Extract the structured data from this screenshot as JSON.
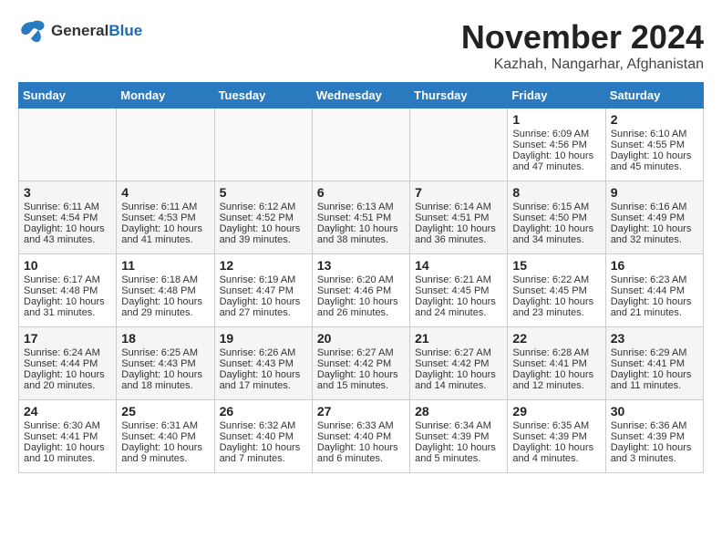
{
  "header": {
    "logo_line1": "General",
    "logo_line2": "Blue",
    "month_title": "November 2024",
    "location": "Kazhah, Nangarhar, Afghanistan"
  },
  "calendar": {
    "days_of_week": [
      "Sunday",
      "Monday",
      "Tuesday",
      "Wednesday",
      "Thursday",
      "Friday",
      "Saturday"
    ],
    "weeks": [
      [
        {
          "day": "",
          "content": ""
        },
        {
          "day": "",
          "content": ""
        },
        {
          "day": "",
          "content": ""
        },
        {
          "day": "",
          "content": ""
        },
        {
          "day": "",
          "content": ""
        },
        {
          "day": "1",
          "content": "Sunrise: 6:09 AM\nSunset: 4:56 PM\nDaylight: 10 hours\nand 47 minutes."
        },
        {
          "day": "2",
          "content": "Sunrise: 6:10 AM\nSunset: 4:55 PM\nDaylight: 10 hours\nand 45 minutes."
        }
      ],
      [
        {
          "day": "3",
          "content": "Sunrise: 6:11 AM\nSunset: 4:54 PM\nDaylight: 10 hours\nand 43 minutes."
        },
        {
          "day": "4",
          "content": "Sunrise: 6:11 AM\nSunset: 4:53 PM\nDaylight: 10 hours\nand 41 minutes."
        },
        {
          "day": "5",
          "content": "Sunrise: 6:12 AM\nSunset: 4:52 PM\nDaylight: 10 hours\nand 39 minutes."
        },
        {
          "day": "6",
          "content": "Sunrise: 6:13 AM\nSunset: 4:51 PM\nDaylight: 10 hours\nand 38 minutes."
        },
        {
          "day": "7",
          "content": "Sunrise: 6:14 AM\nSunset: 4:51 PM\nDaylight: 10 hours\nand 36 minutes."
        },
        {
          "day": "8",
          "content": "Sunrise: 6:15 AM\nSunset: 4:50 PM\nDaylight: 10 hours\nand 34 minutes."
        },
        {
          "day": "9",
          "content": "Sunrise: 6:16 AM\nSunset: 4:49 PM\nDaylight: 10 hours\nand 32 minutes."
        }
      ],
      [
        {
          "day": "10",
          "content": "Sunrise: 6:17 AM\nSunset: 4:48 PM\nDaylight: 10 hours\nand 31 minutes."
        },
        {
          "day": "11",
          "content": "Sunrise: 6:18 AM\nSunset: 4:48 PM\nDaylight: 10 hours\nand 29 minutes."
        },
        {
          "day": "12",
          "content": "Sunrise: 6:19 AM\nSunset: 4:47 PM\nDaylight: 10 hours\nand 27 minutes."
        },
        {
          "day": "13",
          "content": "Sunrise: 6:20 AM\nSunset: 4:46 PM\nDaylight: 10 hours\nand 26 minutes."
        },
        {
          "day": "14",
          "content": "Sunrise: 6:21 AM\nSunset: 4:45 PM\nDaylight: 10 hours\nand 24 minutes."
        },
        {
          "day": "15",
          "content": "Sunrise: 6:22 AM\nSunset: 4:45 PM\nDaylight: 10 hours\nand 23 minutes."
        },
        {
          "day": "16",
          "content": "Sunrise: 6:23 AM\nSunset: 4:44 PM\nDaylight: 10 hours\nand 21 minutes."
        }
      ],
      [
        {
          "day": "17",
          "content": "Sunrise: 6:24 AM\nSunset: 4:44 PM\nDaylight: 10 hours\nand 20 minutes."
        },
        {
          "day": "18",
          "content": "Sunrise: 6:25 AM\nSunset: 4:43 PM\nDaylight: 10 hours\nand 18 minutes."
        },
        {
          "day": "19",
          "content": "Sunrise: 6:26 AM\nSunset: 4:43 PM\nDaylight: 10 hours\nand 17 minutes."
        },
        {
          "day": "20",
          "content": "Sunrise: 6:27 AM\nSunset: 4:42 PM\nDaylight: 10 hours\nand 15 minutes."
        },
        {
          "day": "21",
          "content": "Sunrise: 6:27 AM\nSunset: 4:42 PM\nDaylight: 10 hours\nand 14 minutes."
        },
        {
          "day": "22",
          "content": "Sunrise: 6:28 AM\nSunset: 4:41 PM\nDaylight: 10 hours\nand 12 minutes."
        },
        {
          "day": "23",
          "content": "Sunrise: 6:29 AM\nSunset: 4:41 PM\nDaylight: 10 hours\nand 11 minutes."
        }
      ],
      [
        {
          "day": "24",
          "content": "Sunrise: 6:30 AM\nSunset: 4:41 PM\nDaylight: 10 hours\nand 10 minutes."
        },
        {
          "day": "25",
          "content": "Sunrise: 6:31 AM\nSunset: 4:40 PM\nDaylight: 10 hours\nand 9 minutes."
        },
        {
          "day": "26",
          "content": "Sunrise: 6:32 AM\nSunset: 4:40 PM\nDaylight: 10 hours\nand 7 minutes."
        },
        {
          "day": "27",
          "content": "Sunrise: 6:33 AM\nSunset: 4:40 PM\nDaylight: 10 hours\nand 6 minutes."
        },
        {
          "day": "28",
          "content": "Sunrise: 6:34 AM\nSunset: 4:39 PM\nDaylight: 10 hours\nand 5 minutes."
        },
        {
          "day": "29",
          "content": "Sunrise: 6:35 AM\nSunset: 4:39 PM\nDaylight: 10 hours\nand 4 minutes."
        },
        {
          "day": "30",
          "content": "Sunrise: 6:36 AM\nSunset: 4:39 PM\nDaylight: 10 hours\nand 3 minutes."
        }
      ]
    ]
  }
}
